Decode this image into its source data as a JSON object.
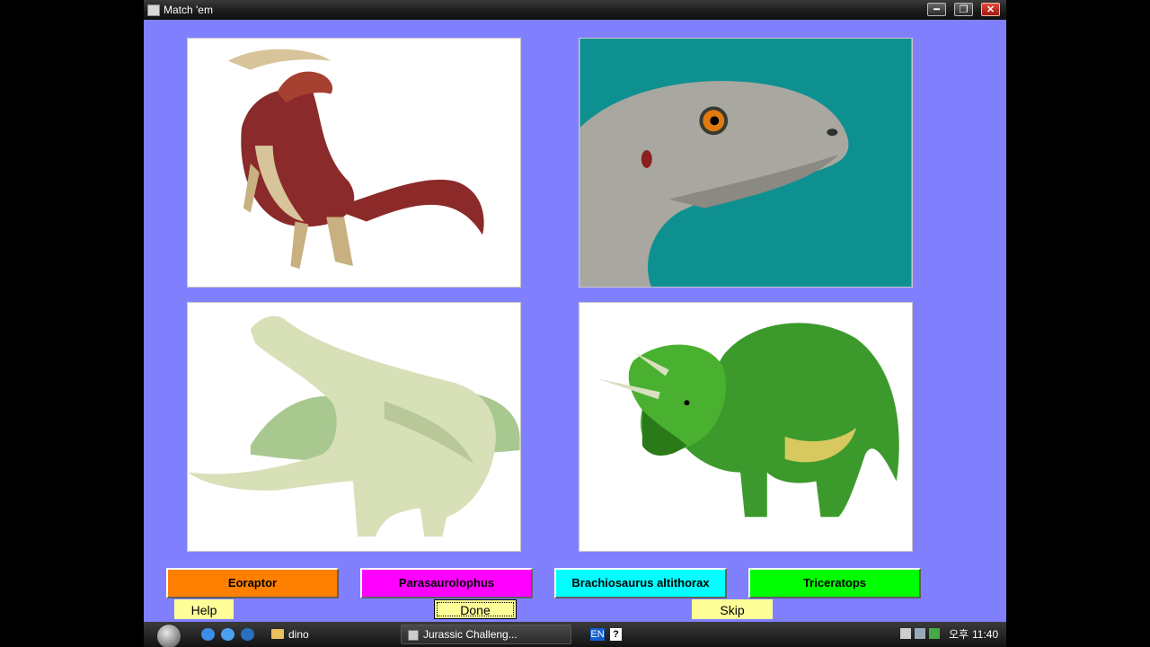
{
  "window": {
    "title": "Match 'em",
    "min_symbol": "━",
    "max_symbol": "❐",
    "close_symbol": "✕"
  },
  "pictures": [
    {
      "subject": "parasaurolophus-drawing"
    },
    {
      "subject": "eoraptor-head-drawing"
    },
    {
      "subject": "brachiosaurus-drawing"
    },
    {
      "subject": "triceratops-drawing"
    }
  ],
  "name_buttons": [
    {
      "label": "Eoraptor",
      "color": "#ff8000"
    },
    {
      "label": "Parasaurolophus",
      "color": "#ff00ff"
    },
    {
      "label": "Brachiosaurus altithorax",
      "color": "#00ffff"
    },
    {
      "label": "Triceratops",
      "color": "#00ff00"
    }
  ],
  "controls": {
    "help": "Help",
    "done": "Done",
    "skip": "Skip"
  },
  "taskbar": {
    "folder_label": "dino",
    "task_label": "Jurassic Challeng...",
    "language": "EN",
    "help_icon": "?",
    "ampm": "오후",
    "time": "11:40"
  }
}
